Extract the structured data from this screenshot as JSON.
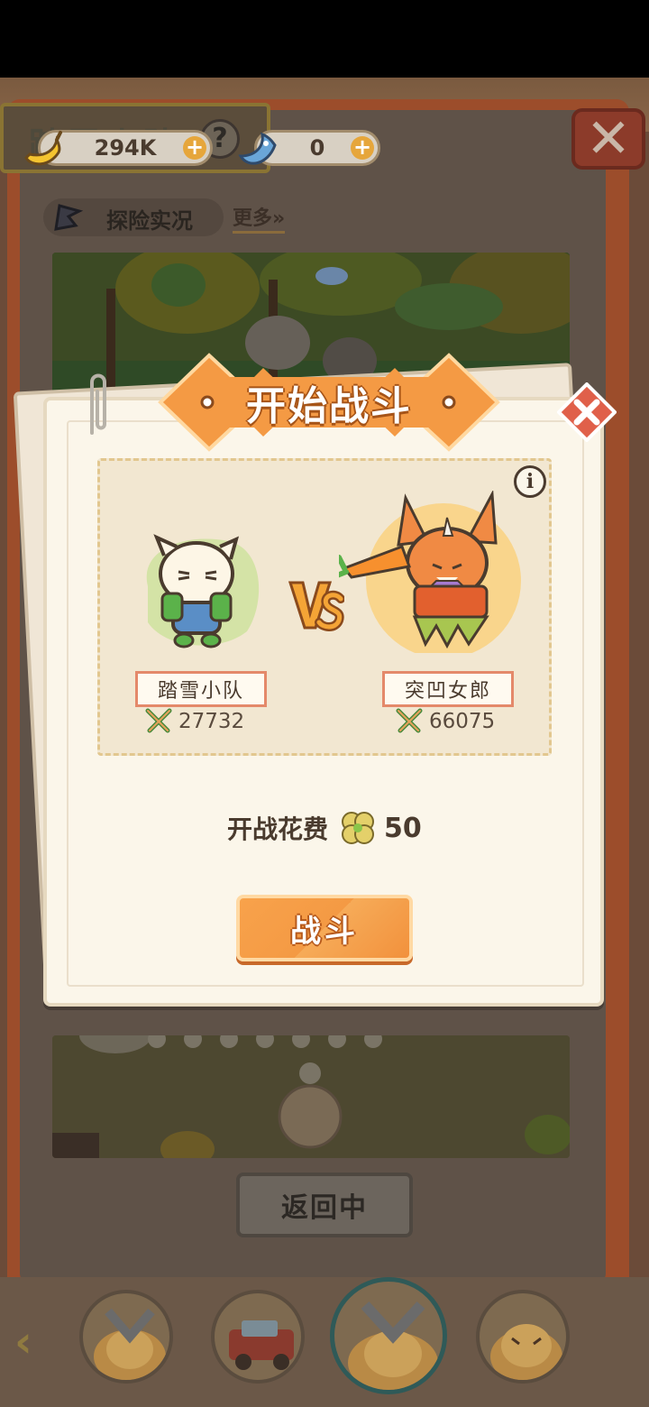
{
  "hud": {
    "team_title": "踏雪小队",
    "help_icon": "?",
    "banana": {
      "icon": "banana-icon",
      "value": "294K",
      "plus": "+"
    },
    "gem": {
      "icon": "blue-fish-gem-icon",
      "value": "0",
      "plus": "+"
    },
    "close_icon": "close-x-icon"
  },
  "live": {
    "label": "探险实况",
    "more": "更多»"
  },
  "return_button": "返回中",
  "modal": {
    "title": "开始战斗",
    "info": "i",
    "left": {
      "name": "踏雪小队",
      "power": "27732"
    },
    "right": {
      "name": "突凹女郎",
      "power": "66075"
    },
    "vs": "VS",
    "cost_label": "开战花费",
    "cost_icon": "clover-icon",
    "cost_value": "50",
    "fight_button": "战斗"
  },
  "colors": {
    "accent_orange": "#f49a44",
    "panel_cream": "#fbf6ea",
    "name_border": "#e4896a",
    "text_brown": "#4a3b2e"
  }
}
